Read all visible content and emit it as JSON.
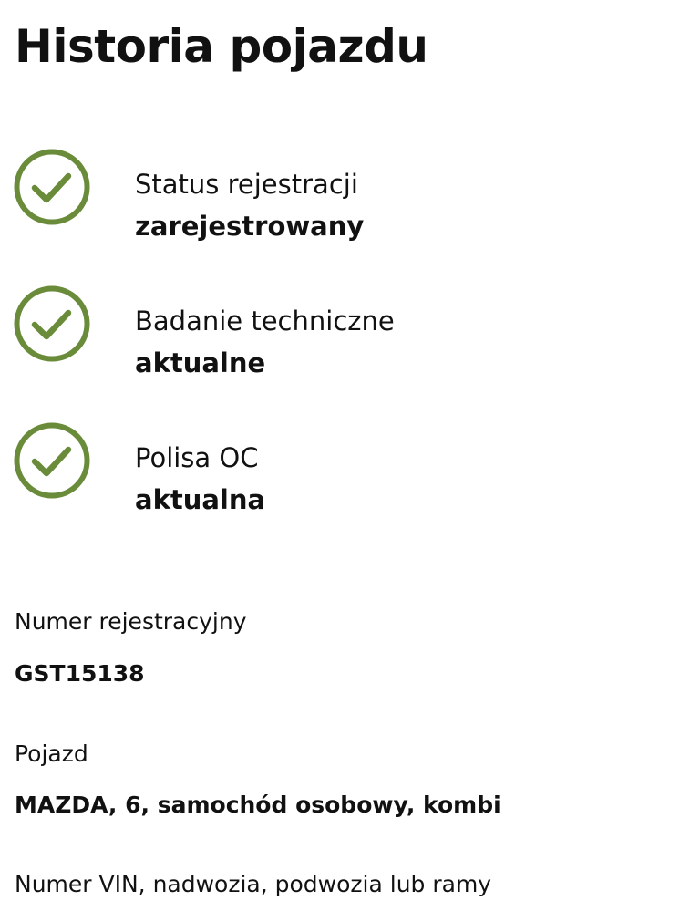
{
  "page": {
    "title": "Historia pojazdu"
  },
  "colors": {
    "accent_green": "#6a8c3a",
    "text": "#111111",
    "background": "#ffffff"
  },
  "status_items": [
    {
      "icon": "check-circle-icon",
      "label": "Status rejestracji",
      "value": "zarejestrowany"
    },
    {
      "icon": "check-circle-icon",
      "label": "Badanie techniczne",
      "value": "aktualne"
    },
    {
      "icon": "check-circle-icon",
      "label": "Polisa OC",
      "value": "aktualna"
    }
  ],
  "details": {
    "registration_number": {
      "label": "Numer rejestracyjny",
      "value": "GST15138"
    },
    "vehicle": {
      "label": "Pojazd",
      "value": "MAZDA, 6, samochód osobowy, kombi"
    },
    "vin": {
      "label": "Numer VIN, nadwozia, podwozia lub ramy"
    }
  }
}
